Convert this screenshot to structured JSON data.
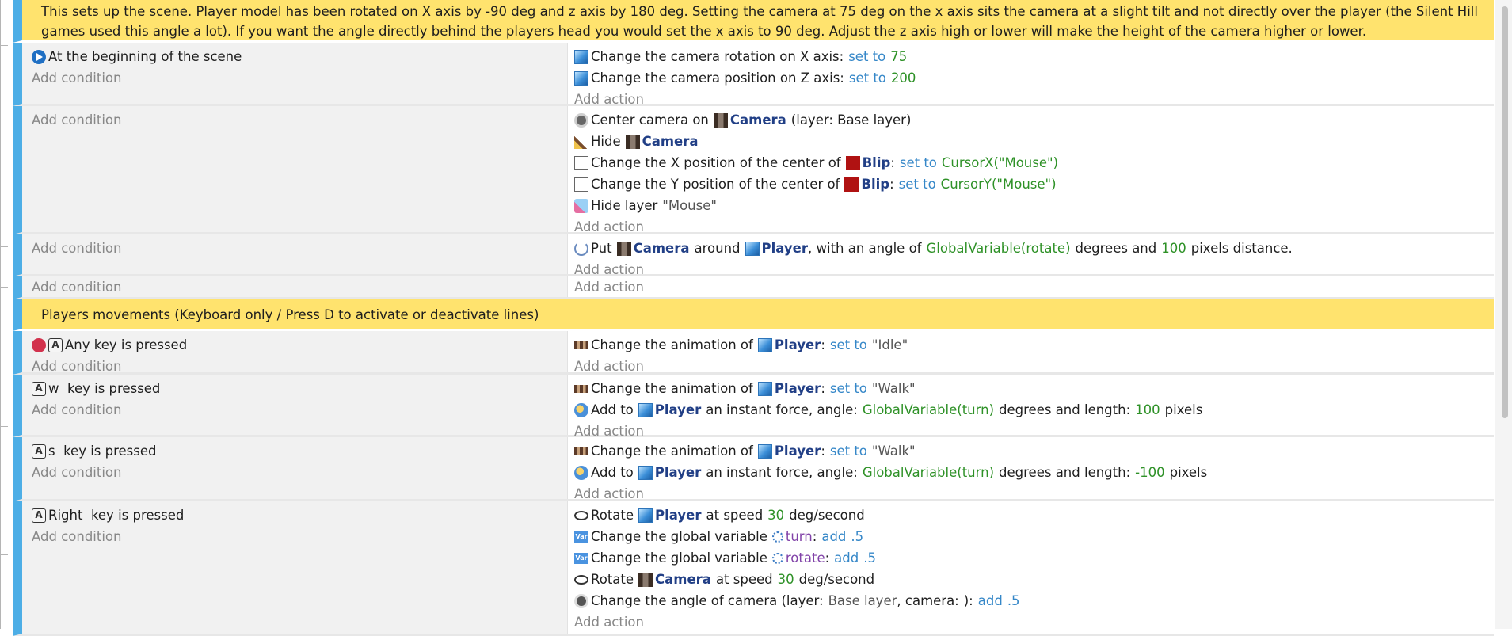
{
  "comments": {
    "scene_setup": "This sets up the scene. Player model has been rotated on X axis by -90 deg and z axis by 180 deg. Setting the camera at 75 deg on the x axis sits the camera at a slight tilt and not directly over the player (the Silent Hill games used this angle a lot). If you want the angle directly behind the players head you would set the x axis to 90 deg. Adjust the z axis high or lower will make the height of the camera higher or lower.",
    "movements": "Players movements (Keyboard only / Press D to activate or deactivate lines)"
  },
  "labels": {
    "add_condition": "Add condition",
    "add_action": "Add action"
  },
  "objects": {
    "camera": "Camera",
    "player": "Player",
    "blip": "Blip"
  },
  "event1": {
    "condition": "At the beginning of the scene",
    "a1": {
      "text": "Change the camera rotation on X axis:",
      "op": "set to",
      "val": "75"
    },
    "a2": {
      "text": "Change the camera position on Z axis:",
      "op": "set to",
      "val": "200"
    }
  },
  "event2": {
    "a1_pre": "Center camera on",
    "a1_post": "(layer: Base layer)",
    "a2_pre": "Hide",
    "a3_pre": "Change the X position of the center of",
    "a3_op": "set to",
    "a3_val": "CursorX(\"Mouse\")",
    "a4_pre": "Change the Y position of the center of",
    "a4_op": "set to",
    "a4_val": "CursorY(\"Mouse\")",
    "a5_pre": "Hide layer",
    "a5_str": "\"Mouse\""
  },
  "event3": {
    "pre": "Put",
    "mid": "around",
    "mid2": ", with an angle of",
    "val1": "GlobalVariable(rotate)",
    "mid3": "degrees and",
    "val2": "100",
    "post": "pixels distance."
  },
  "event5": {
    "condition": "Any key is pressed",
    "a1_pre": "Change the animation of",
    "a1_op": "set to",
    "a1_str": "\"Idle\""
  },
  "event6": {
    "condition": "w  key is pressed",
    "a1_pre": "Change the animation of",
    "a1_op": "set to",
    "a1_str": "\"Walk\"",
    "a2_pre": "Add to",
    "a2_mid": "an instant force, angle:",
    "a2_val1": "GlobalVariable(turn)",
    "a2_mid2": "degrees and length:",
    "a2_val2": "100",
    "a2_post": "pixels"
  },
  "event7": {
    "condition": "s  key is pressed",
    "a1_pre": "Change the animation of",
    "a1_op": "set to",
    "a1_str": "\"Walk\"",
    "a2_pre": "Add to",
    "a2_mid": "an instant force, angle:",
    "a2_val1": "GlobalVariable(turn)",
    "a2_mid2": "degrees and length:",
    "a2_val2": "-100",
    "a2_post": "pixels"
  },
  "event8": {
    "condition": "Right  key is pressed",
    "a1_pre": "Rotate",
    "a1_mid": "at speed",
    "a1_val": "30",
    "a1_post": "deg/second",
    "a2_pre": "Change the global variable",
    "a2_var": "turn",
    "a2_op": "add",
    "a2_val": ".5",
    "a3_pre": "Change the global variable",
    "a3_var": "rotate",
    "a3_op": "add",
    "a3_val": ".5",
    "a4_pre": "Rotate",
    "a4_mid": "at speed",
    "a4_val": "30",
    "a4_post": "deg/second",
    "a5_pre": "Change the angle of camera (layer:",
    "a5_layer": "Base layer",
    "a5_mid": ", camera:",
    "a5_post": "):",
    "a5_op": "add",
    "a5_val": ".5"
  },
  "icons": {
    "start": "scene-start-icon",
    "camera3d": "camera-3d-icon",
    "camera": "camera-icon",
    "pencil": "visibility-pencil-icon",
    "position": "position-icon",
    "layer": "layer-eraser-icon",
    "orbit": "orbit-icon",
    "anykey": "any-key-icon",
    "key": "keyboard-key-icon",
    "anim": "animation-icon",
    "force": "force-icon",
    "rotate": "rotate-icon",
    "var": "variable-icon"
  }
}
